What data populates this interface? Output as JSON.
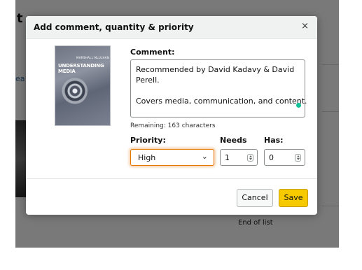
{
  "background": {
    "title_fragment": "t",
    "link_fragment": "ea",
    "end_of_list": "End of list"
  },
  "modal": {
    "title": "Add comment, quantity & priority",
    "close_glyph": "×",
    "book_cover": {
      "author": "MARSHALL McLUHAN",
      "title": "UNDERSTANDING MEDIA"
    },
    "comment_label": "Comment:",
    "comment_lines": [
      "Recommended by David Kadavy & David",
      "Perell.",
      "",
      "Covers media, communication, and content."
    ],
    "remaining_text": "Remaining: 163 characters",
    "priority_label": "Priority:",
    "priority_value": "High",
    "needs_label": "Needs",
    "needs_value": "1",
    "has_label": "Has:",
    "has_value": "0",
    "cancel_label": "Cancel",
    "save_label": "Save"
  },
  "icons": {
    "close": "close-icon",
    "chevron": "chevron-down-icon",
    "stepper": "stepper-arrows-icon",
    "grammar": "grammar-check-dot-icon"
  },
  "colors": {
    "save_button": "#f7ca00",
    "focus_outline": "#e77600",
    "grammar_dot": "#15c39a",
    "header_bg": "#f0f2f2"
  }
}
